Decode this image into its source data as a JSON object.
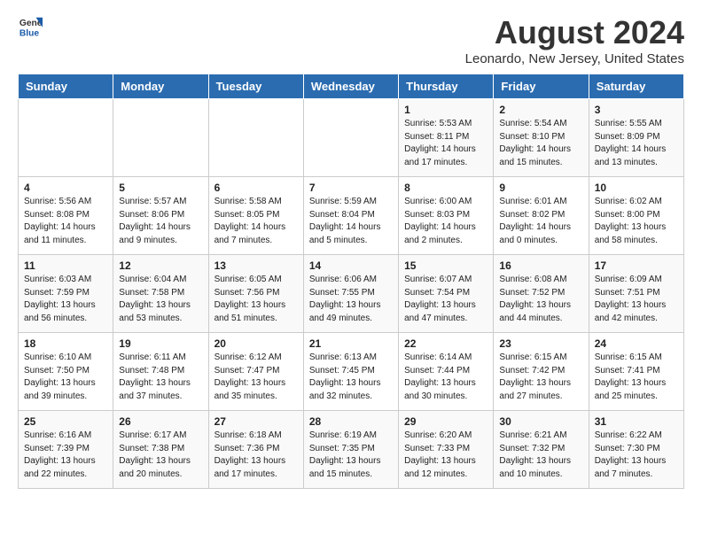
{
  "header": {
    "logo_line1": "General",
    "logo_line2": "Blue",
    "title": "August 2024",
    "subtitle": "Leonardo, New Jersey, United States"
  },
  "days_of_week": [
    "Sunday",
    "Monday",
    "Tuesday",
    "Wednesday",
    "Thursday",
    "Friday",
    "Saturday"
  ],
  "weeks": [
    [
      {
        "num": "",
        "info": ""
      },
      {
        "num": "",
        "info": ""
      },
      {
        "num": "",
        "info": ""
      },
      {
        "num": "",
        "info": ""
      },
      {
        "num": "1",
        "info": "Sunrise: 5:53 AM\nSunset: 8:11 PM\nDaylight: 14 hours\nand 17 minutes."
      },
      {
        "num": "2",
        "info": "Sunrise: 5:54 AM\nSunset: 8:10 PM\nDaylight: 14 hours\nand 15 minutes."
      },
      {
        "num": "3",
        "info": "Sunrise: 5:55 AM\nSunset: 8:09 PM\nDaylight: 14 hours\nand 13 minutes."
      }
    ],
    [
      {
        "num": "4",
        "info": "Sunrise: 5:56 AM\nSunset: 8:08 PM\nDaylight: 14 hours\nand 11 minutes."
      },
      {
        "num": "5",
        "info": "Sunrise: 5:57 AM\nSunset: 8:06 PM\nDaylight: 14 hours\nand 9 minutes."
      },
      {
        "num": "6",
        "info": "Sunrise: 5:58 AM\nSunset: 8:05 PM\nDaylight: 14 hours\nand 7 minutes."
      },
      {
        "num": "7",
        "info": "Sunrise: 5:59 AM\nSunset: 8:04 PM\nDaylight: 14 hours\nand 5 minutes."
      },
      {
        "num": "8",
        "info": "Sunrise: 6:00 AM\nSunset: 8:03 PM\nDaylight: 14 hours\nand 2 minutes."
      },
      {
        "num": "9",
        "info": "Sunrise: 6:01 AM\nSunset: 8:02 PM\nDaylight: 14 hours\nand 0 minutes."
      },
      {
        "num": "10",
        "info": "Sunrise: 6:02 AM\nSunset: 8:00 PM\nDaylight: 13 hours\nand 58 minutes."
      }
    ],
    [
      {
        "num": "11",
        "info": "Sunrise: 6:03 AM\nSunset: 7:59 PM\nDaylight: 13 hours\nand 56 minutes."
      },
      {
        "num": "12",
        "info": "Sunrise: 6:04 AM\nSunset: 7:58 PM\nDaylight: 13 hours\nand 53 minutes."
      },
      {
        "num": "13",
        "info": "Sunrise: 6:05 AM\nSunset: 7:56 PM\nDaylight: 13 hours\nand 51 minutes."
      },
      {
        "num": "14",
        "info": "Sunrise: 6:06 AM\nSunset: 7:55 PM\nDaylight: 13 hours\nand 49 minutes."
      },
      {
        "num": "15",
        "info": "Sunrise: 6:07 AM\nSunset: 7:54 PM\nDaylight: 13 hours\nand 47 minutes."
      },
      {
        "num": "16",
        "info": "Sunrise: 6:08 AM\nSunset: 7:52 PM\nDaylight: 13 hours\nand 44 minutes."
      },
      {
        "num": "17",
        "info": "Sunrise: 6:09 AM\nSunset: 7:51 PM\nDaylight: 13 hours\nand 42 minutes."
      }
    ],
    [
      {
        "num": "18",
        "info": "Sunrise: 6:10 AM\nSunset: 7:50 PM\nDaylight: 13 hours\nand 39 minutes."
      },
      {
        "num": "19",
        "info": "Sunrise: 6:11 AM\nSunset: 7:48 PM\nDaylight: 13 hours\nand 37 minutes."
      },
      {
        "num": "20",
        "info": "Sunrise: 6:12 AM\nSunset: 7:47 PM\nDaylight: 13 hours\nand 35 minutes."
      },
      {
        "num": "21",
        "info": "Sunrise: 6:13 AM\nSunset: 7:45 PM\nDaylight: 13 hours\nand 32 minutes."
      },
      {
        "num": "22",
        "info": "Sunrise: 6:14 AM\nSunset: 7:44 PM\nDaylight: 13 hours\nand 30 minutes."
      },
      {
        "num": "23",
        "info": "Sunrise: 6:15 AM\nSunset: 7:42 PM\nDaylight: 13 hours\nand 27 minutes."
      },
      {
        "num": "24",
        "info": "Sunrise: 6:15 AM\nSunset: 7:41 PM\nDaylight: 13 hours\nand 25 minutes."
      }
    ],
    [
      {
        "num": "25",
        "info": "Sunrise: 6:16 AM\nSunset: 7:39 PM\nDaylight: 13 hours\nand 22 minutes."
      },
      {
        "num": "26",
        "info": "Sunrise: 6:17 AM\nSunset: 7:38 PM\nDaylight: 13 hours\nand 20 minutes."
      },
      {
        "num": "27",
        "info": "Sunrise: 6:18 AM\nSunset: 7:36 PM\nDaylight: 13 hours\nand 17 minutes."
      },
      {
        "num": "28",
        "info": "Sunrise: 6:19 AM\nSunset: 7:35 PM\nDaylight: 13 hours\nand 15 minutes."
      },
      {
        "num": "29",
        "info": "Sunrise: 6:20 AM\nSunset: 7:33 PM\nDaylight: 13 hours\nand 12 minutes."
      },
      {
        "num": "30",
        "info": "Sunrise: 6:21 AM\nSunset: 7:32 PM\nDaylight: 13 hours\nand 10 minutes."
      },
      {
        "num": "31",
        "info": "Sunrise: 6:22 AM\nSunset: 7:30 PM\nDaylight: 13 hours\nand 7 minutes."
      }
    ]
  ]
}
